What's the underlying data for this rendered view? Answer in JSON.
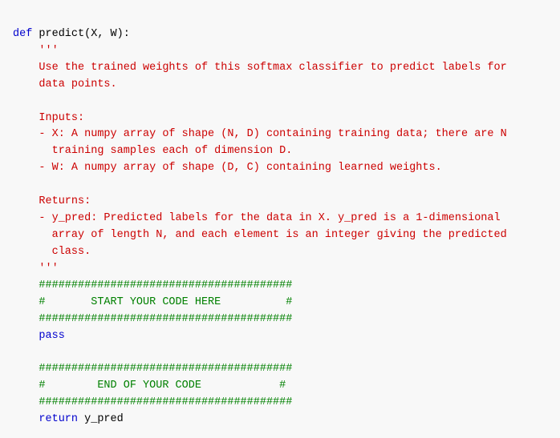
{
  "code": {
    "lines": [
      {
        "type": "def",
        "text": "def predict(X, W):"
      },
      {
        "type": "docstring",
        "text": "    '''"
      },
      {
        "type": "docstring",
        "text": "    Use the trained weights of this softmax classifier to predict labels for"
      },
      {
        "type": "docstring",
        "text": "    data points."
      },
      {
        "type": "docstring",
        "text": ""
      },
      {
        "type": "docstring",
        "text": "    Inputs:"
      },
      {
        "type": "docstring",
        "text": "    - X: A numpy array of shape (N, D) containing training data; there are N"
      },
      {
        "type": "docstring",
        "text": "      training samples each of dimension D."
      },
      {
        "type": "docstring",
        "text": "    - W: A numpy array of shape (D, C) containing learned weights."
      },
      {
        "type": "docstring",
        "text": ""
      },
      {
        "type": "docstring",
        "text": "    Returns:"
      },
      {
        "type": "docstring",
        "text": "    - y_pred: Predicted labels for the data in X. y_pred is a 1-dimensional"
      },
      {
        "type": "docstring",
        "text": "      array of length N, and each element is an integer giving the predicted"
      },
      {
        "type": "docstring",
        "text": "      class."
      },
      {
        "type": "docstring",
        "text": "    '''"
      },
      {
        "type": "comment",
        "text": "    #######################################"
      },
      {
        "type": "comment",
        "text": "    #       START YOUR CODE HERE          #"
      },
      {
        "type": "comment",
        "text": "    #######################################"
      },
      {
        "type": "pass",
        "text": "    pass"
      },
      {
        "type": "blank",
        "text": ""
      },
      {
        "type": "comment",
        "text": "    #######################################"
      },
      {
        "type": "comment",
        "text": "    #        END OF YOUR CODE            #"
      },
      {
        "type": "comment",
        "text": "    #######################################"
      },
      {
        "type": "return",
        "text": "    return y_pred"
      }
    ]
  }
}
